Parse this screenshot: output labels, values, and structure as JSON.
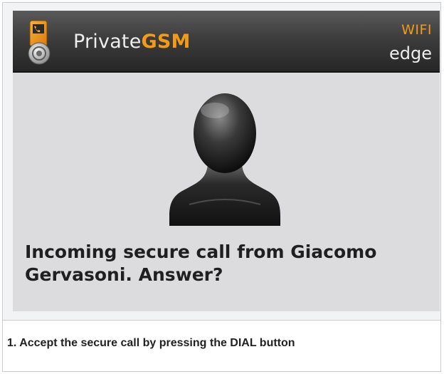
{
  "app": {
    "title_prefix": "Private",
    "title_brand": "GSM",
    "icon": "phone-lock-icon"
  },
  "network": {
    "primary": "WIFI",
    "secondary": "edge"
  },
  "call": {
    "avatar_icon": "contact-silhouette-icon",
    "message": "Incoming secure call from Giacomo Gervasoni. Answer?"
  },
  "caption": {
    "text": "1. Accept the secure call by pressing the DIAL button"
  },
  "colors": {
    "accent": "#f39a17",
    "titlebar": "#333333",
    "screen_bg": "#dcdcde"
  }
}
